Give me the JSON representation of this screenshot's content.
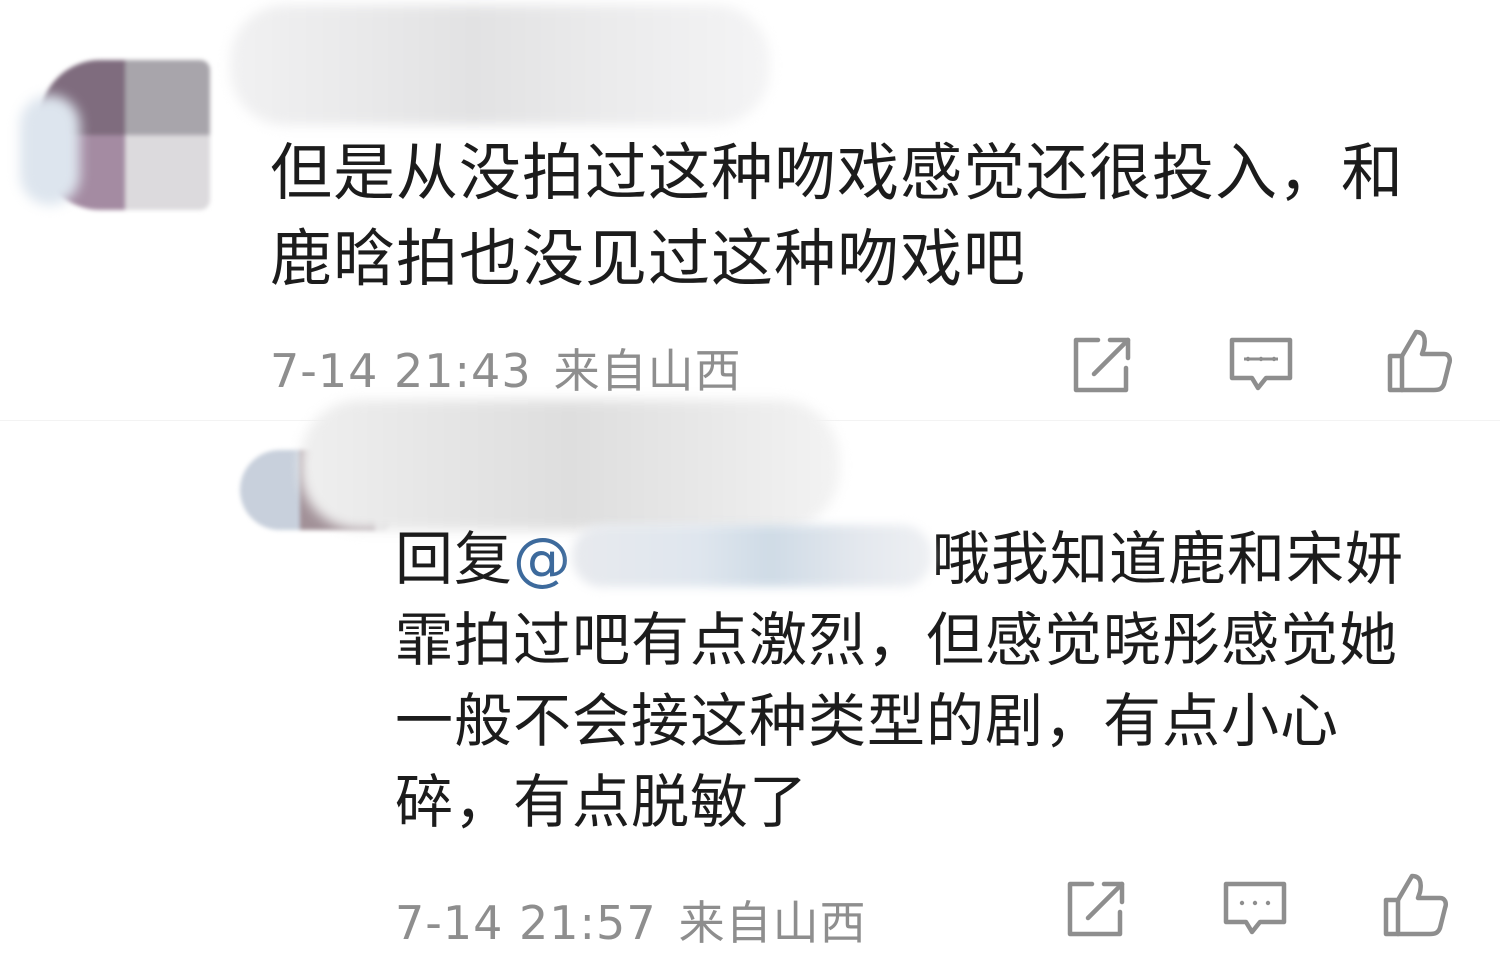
{
  "comments": [
    {
      "text": "但是从没拍过这种吻戏感觉还很投入，和鹿晗拍也没见过这种吻戏吧",
      "time": "7-14 21:43",
      "location": "来自山西",
      "actions": [
        "share-icon",
        "comment-icon",
        "like-icon"
      ]
    },
    {
      "reply_prefix": "回复",
      "mention_at": "@",
      "text": "哦我知道鹿和宋妍霏拍过吧有点激烈，但感觉晓彤感觉她一般不会接这种类型的剧，有点小心碎，有点脱敏了",
      "time": "7-14 21:57",
      "location": "来自山西",
      "actions": [
        "share-icon",
        "comment-icon",
        "like-icon"
      ]
    }
  ],
  "colors": {
    "text": "#1c1c1c",
    "meta": "#8e8e8e",
    "mention": "#3d6a9c",
    "icon": "#8e8e8e"
  }
}
